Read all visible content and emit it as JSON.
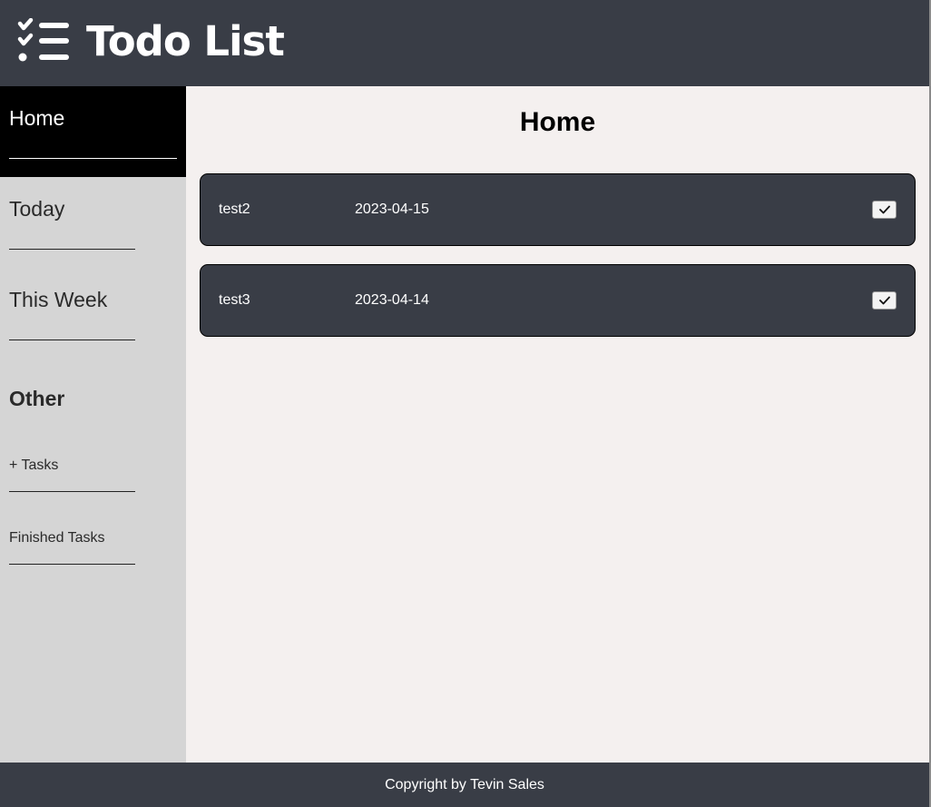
{
  "header": {
    "title": "Todo List",
    "logo_icon": "checklist-icon"
  },
  "sidebar": {
    "items": [
      {
        "label": "Home",
        "active": true
      },
      {
        "label": "Today",
        "active": false
      },
      {
        "label": "This Week",
        "active": false
      }
    ],
    "other_heading": "Other",
    "other_items": [
      {
        "label": "+ Tasks"
      },
      {
        "label": "Finished Tasks"
      }
    ]
  },
  "main": {
    "title": "Home",
    "tasks": [
      {
        "name": "test2",
        "date": "2023-04-15",
        "check_icon": "checkmark-icon"
      },
      {
        "name": "test3",
        "date": "2023-04-14",
        "check_icon": "checkmark-icon"
      }
    ]
  },
  "footer": {
    "text": "Copyright by Tevin Sales"
  },
  "colors": {
    "header_bg": "#393d46",
    "sidebar_bg": "#d5d5d5",
    "active_bg": "#000000",
    "main_bg": "#f4f0ef",
    "card_bg": "#393d46"
  }
}
